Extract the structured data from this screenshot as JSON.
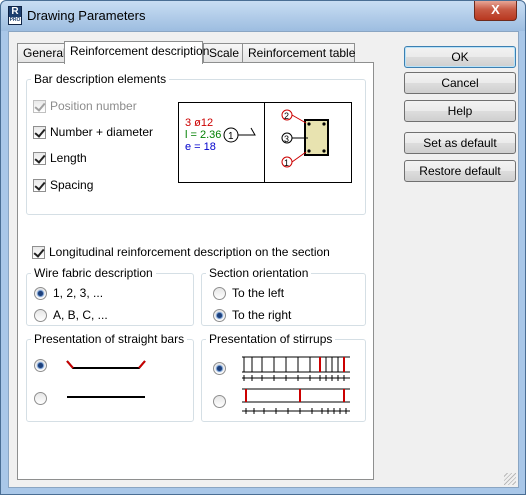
{
  "window": {
    "title": "Drawing Parameters",
    "close_glyph": "X",
    "app_icon": {
      "letter": "R",
      "badge": "PRO"
    }
  },
  "tabs": [
    {
      "label": "General",
      "active": false
    },
    {
      "label": "Reinforcement description",
      "active": true
    },
    {
      "label": "Scale",
      "active": false
    },
    {
      "label": "Reinforcement table",
      "active": false
    }
  ],
  "bar_description": {
    "group_label": "Bar description elements",
    "items": [
      {
        "label": "Position number",
        "checked": true,
        "enabled": false
      },
      {
        "label": "Number + diameter",
        "checked": true,
        "enabled": true
      },
      {
        "label": "Length",
        "checked": true,
        "enabled": true
      },
      {
        "label": "Spacing",
        "checked": true,
        "enabled": true
      }
    ],
    "preview": {
      "line1": "3 ø12",
      "line2": "l = 2.36",
      "line3": "e = 18",
      "position_marker": "1",
      "section_markers": [
        "2",
        "3",
        "1"
      ],
      "colors": {
        "line1": "#cc0000",
        "line2": "#008000",
        "line3": "#0000cc",
        "section_fill": "#e8e3b0"
      }
    }
  },
  "longitudinal": {
    "label": "Longitudinal reinforcement description on the section",
    "checked": true
  },
  "wire_fabric": {
    "group_label": "Wire fabric description",
    "options": [
      {
        "label": "1, 2, 3, ...",
        "checked": true
      },
      {
        "label": "A, B, C, ...",
        "checked": false
      }
    ]
  },
  "section_orientation": {
    "group_label": "Section orientation",
    "options": [
      {
        "label": "To the left",
        "checked": false
      },
      {
        "label": "To the right",
        "checked": true
      }
    ]
  },
  "straight_bars": {
    "group_label": "Presentation of straight bars",
    "options": [
      {
        "style": "hooked-ends",
        "checked": true
      },
      {
        "style": "straight",
        "checked": false
      }
    ],
    "colors": {
      "hooked": "#cc0000",
      "bar": "#000000"
    }
  },
  "stirrups": {
    "group_label": "Presentation of stirrups",
    "options": [
      {
        "style": "full-lines",
        "checked": true
      },
      {
        "style": "ticks",
        "checked": false
      }
    ],
    "colors": {
      "main": "#cc0000",
      "ticks": "#000000"
    }
  },
  "buttons": {
    "ok": "OK",
    "cancel": "Cancel",
    "help": "Help",
    "set_default": "Set as default",
    "restore_default": "Restore default"
  }
}
